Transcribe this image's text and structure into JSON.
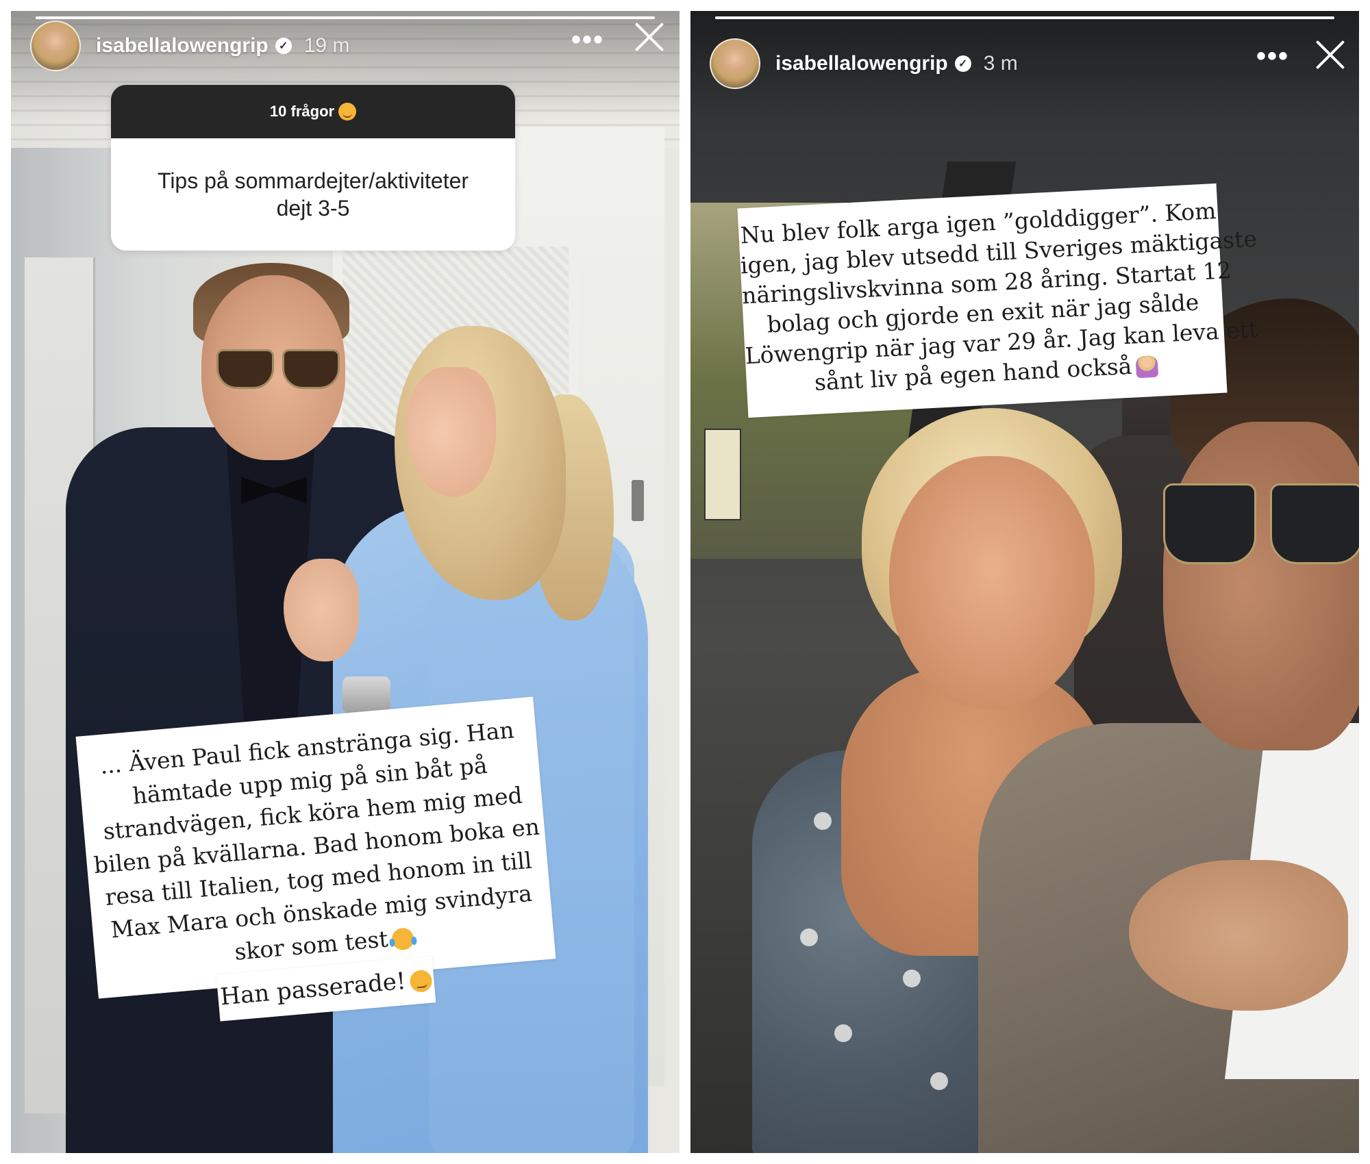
{
  "stories": [
    {
      "username": "isabellalowengrip",
      "time": "19 m",
      "more_label": "•••",
      "question_sticker": {
        "header": "10 frågor",
        "question_lines": [
          "Tips på sommardejter/aktiviteter",
          "dejt 3-5"
        ]
      },
      "answer_lines": [
        "... Även Paul fick anstränga sig. Han",
        "hämtade upp mig på sin båt på",
        "strandvägen, fick köra hem mig med",
        "bilen på kvällarna. Bad honom boka en",
        "resa till Italien, tog med honom in till",
        "Max Mara och önskade mig svindyra",
        "skor som test"
      ],
      "passed_text": "Han passerade!",
      "icons": {
        "header_emoji": "smiling-face-with-hearts-icon",
        "answer_emoji": "tears-of-joy-icon",
        "passed_emoji": "smirking-face-icon"
      }
    },
    {
      "username": "isabellalowengrip",
      "time": "3 m",
      "more_label": "•••",
      "statement_lines": [
        "Nu blev folk arga igen ”golddigger”. Kom",
        "igen, jag blev utsedd till Sveriges mäktigaste",
        "näringslivskvinna som 28 åring. Startat 12",
        "bolag och gjorde en exit när jag sålde",
        "Löwengrip när jag var 29 år. Jag kan leva ett",
        "sånt liv på egen hand också"
      ],
      "icons": {
        "statement_emoji": "person-tipping-hand-icon"
      }
    }
  ]
}
